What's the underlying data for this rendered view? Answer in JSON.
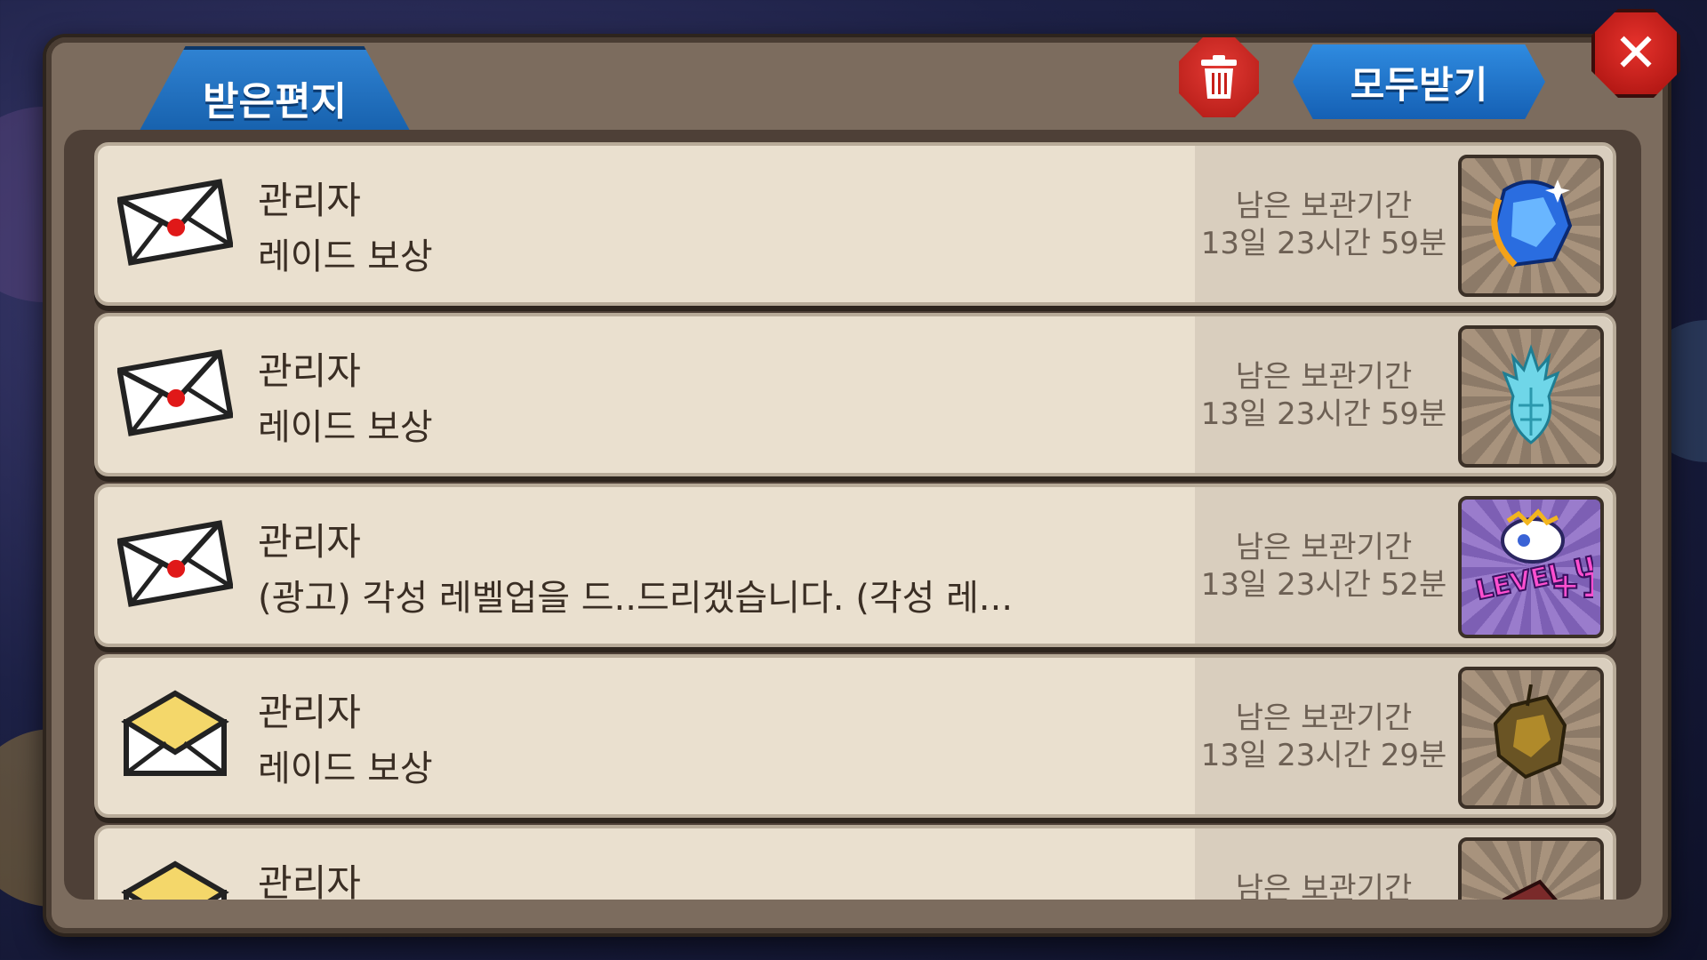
{
  "tab": {
    "label": "받은편지"
  },
  "header": {
    "get_all_label": "모두받기"
  },
  "mails": [
    {
      "sender": "관리자",
      "title": "레이드 보상",
      "expiry_label": "남은 보관기간",
      "expiry_time": "13일 23시간 59분",
      "reward_icon": "blue-gem-icon",
      "envelope": "sealed"
    },
    {
      "sender": "관리자",
      "title": "레이드 보상",
      "expiry_label": "남은 보관기간",
      "expiry_time": "13일 23시간 59분",
      "reward_icon": "cyan-crystal-icon",
      "envelope": "sealed"
    },
    {
      "sender": "관리자",
      "title": "(광고) 각성 레벨업을 드..드리겠습니다. (각성 레...",
      "expiry_label": "남은 보관기간",
      "expiry_time": "13일 23시간 52분",
      "reward_icon": "level-up-plus-1-icon",
      "envelope": "sealed"
    },
    {
      "sender": "관리자",
      "title": "레이드 보상",
      "expiry_label": "남은 보관기간",
      "expiry_time": "13일 23시간 29분",
      "reward_icon": "gold-ore-icon",
      "envelope": "opened"
    },
    {
      "sender": "관리자",
      "title": "",
      "expiry_label": "남은 보관기간",
      "expiry_time": "",
      "reward_icon": "red-ore-icon",
      "envelope": "opened"
    }
  ],
  "reward_text": {
    "level_up": "LEVEL UP",
    "plus_one": "+1"
  }
}
